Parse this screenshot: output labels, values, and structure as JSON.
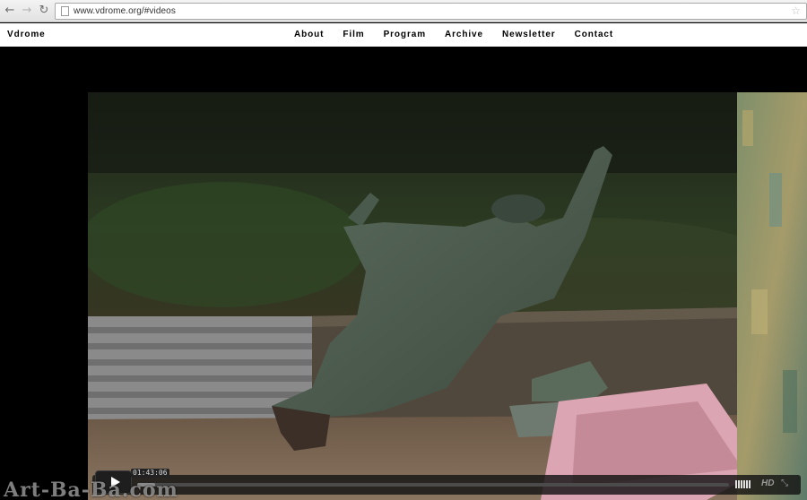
{
  "browser": {
    "back_icon": "arrow-left-icon",
    "forward_icon": "arrow-right-icon",
    "reload_icon": "reload-icon",
    "url": "www.vdrome.org/#videos"
  },
  "site": {
    "brand": "Vdrome",
    "menu": [
      {
        "label": "About"
      },
      {
        "label": "Film"
      },
      {
        "label": "Program"
      },
      {
        "label": "Archive"
      },
      {
        "label": "Newsletter"
      },
      {
        "label": "Contact"
      }
    ]
  },
  "player": {
    "timecode": "01:43:06",
    "progress": 0.03,
    "hd_label": "HD",
    "fullscreen_icon": "fullscreen-icon",
    "play_icon": "play-icon"
  },
  "watermark": "Art-Ba-Ba.com",
  "colors": {
    "header_bg": "#ffffff",
    "stage_bg": "#000000",
    "controls_bg": "#141414"
  }
}
